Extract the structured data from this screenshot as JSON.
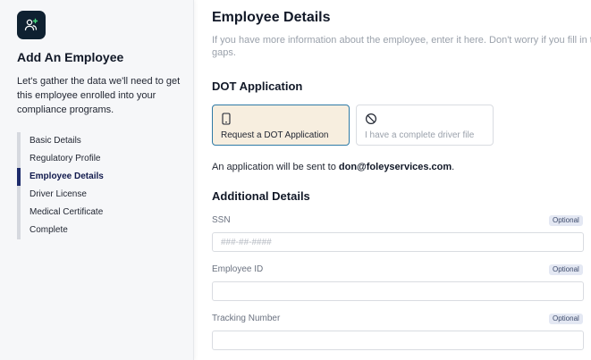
{
  "sidebar": {
    "logo_icon": "users-plus-icon",
    "title": "Add An Employee",
    "description": "Let's gather the data we'll need to get this employee enrolled into your compliance programs.",
    "steps": [
      {
        "label": "Basic Details",
        "active": false
      },
      {
        "label": "Regulatory Profile",
        "active": false
      },
      {
        "label": "Employee Details",
        "active": true
      },
      {
        "label": "Driver License",
        "active": false
      },
      {
        "label": "Medical Certificate",
        "active": false
      },
      {
        "label": "Complete",
        "active": false
      }
    ]
  },
  "main": {
    "title": "Employee Details",
    "description": "If you have more information about the employee, enter it here. Don't worry if you fill in the gaps.",
    "dot_section": {
      "title": "DOT Application",
      "options": [
        {
          "label": "Request a DOT Application",
          "icon": "phone-icon",
          "selected": true
        },
        {
          "label": "I have a complete driver file",
          "icon": "ban-icon",
          "selected": false
        }
      ],
      "note_prefix": "An application will be sent to ",
      "note_email": "don@foleyservices.com",
      "note_suffix": "."
    },
    "additional": {
      "title": "Additional Details",
      "fields": [
        {
          "label": "SSN",
          "badge": "Optional",
          "placeholder": "###-##-####",
          "value": ""
        },
        {
          "label": "Employee ID",
          "badge": "Optional",
          "placeholder": "",
          "value": ""
        },
        {
          "label": "Tracking Number",
          "badge": "Optional",
          "placeholder": "",
          "value": ""
        }
      ]
    }
  },
  "colors": {
    "accent": "#1d2b6b",
    "selected_bg": "#f7eedf",
    "selected_border": "#2e7aa6",
    "logo_bg": "#0f2131"
  }
}
